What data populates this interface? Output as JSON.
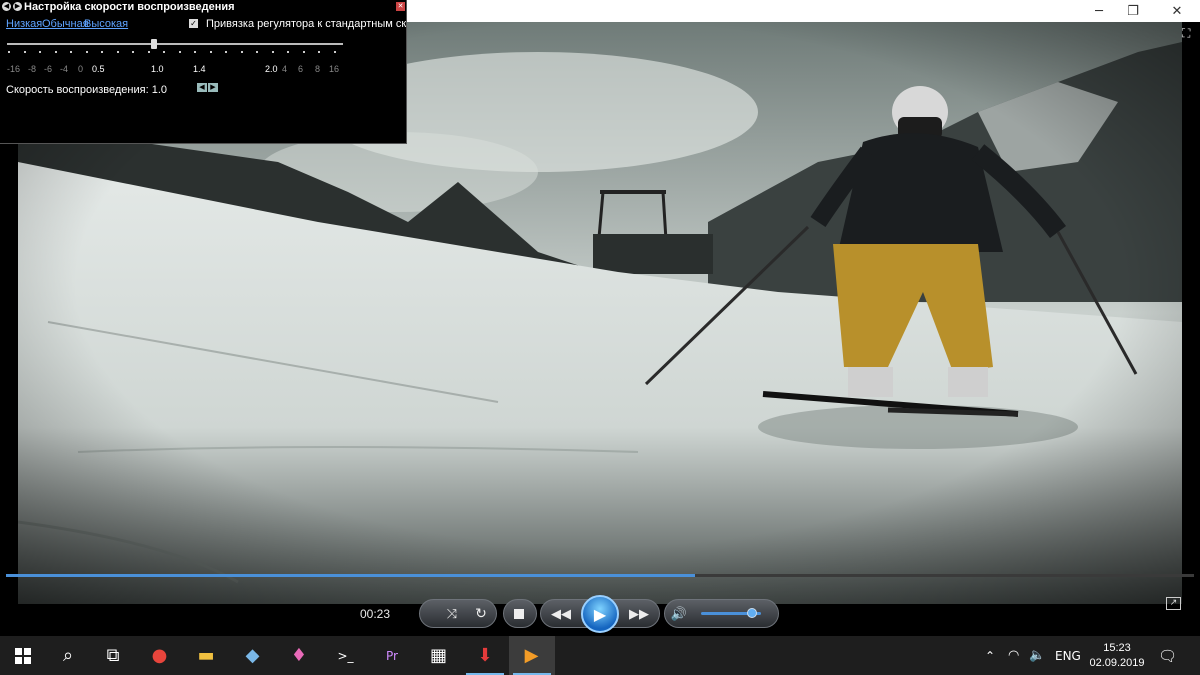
{
  "window": {
    "minimize_glyph": "─",
    "maximize_glyph": "❐",
    "close_glyph": "✕"
  },
  "speed_dialog": {
    "title": "Настройка скорости воспроизведения",
    "preset_low": "Низкая",
    "preset_normal": "Обычная",
    "preset_high": "Высокая",
    "snap_checkbox_label": "Привязка регулятора к стандартным скорос",
    "snap_checked": true,
    "tick_labels": [
      "-16",
      "-8",
      "-6",
      "-4",
      "0",
      "0.5",
      "1.0",
      "1.4",
      "2.0",
      "4",
      "6",
      "8",
      "16"
    ],
    "current_speed_label": "Скорость воспроизведения: 1.0",
    "current_speed": 1.0
  },
  "player": {
    "elapsed_time": "00:23",
    "progress_fraction": 0.58,
    "volume_fraction": 0.85,
    "accent_color": "#4a90d9"
  },
  "taskbar": {
    "pinned": [
      {
        "name": "task-view",
        "glyph": "⧉"
      },
      {
        "name": "chrome",
        "glyph": "●"
      },
      {
        "name": "file-explorer",
        "glyph": "▬"
      },
      {
        "name": "app-blue",
        "glyph": "◆"
      },
      {
        "name": "paint-3d",
        "glyph": "♦"
      },
      {
        "name": "terminal",
        "glyph": ">_"
      },
      {
        "name": "premiere",
        "glyph": "Pr"
      },
      {
        "name": "calculator",
        "glyph": "▦"
      },
      {
        "name": "downloader",
        "glyph": "⬇"
      },
      {
        "name": "media-player",
        "glyph": "▶"
      }
    ],
    "language": "ENG",
    "time": "15:23",
    "date": "02.09.2019"
  }
}
